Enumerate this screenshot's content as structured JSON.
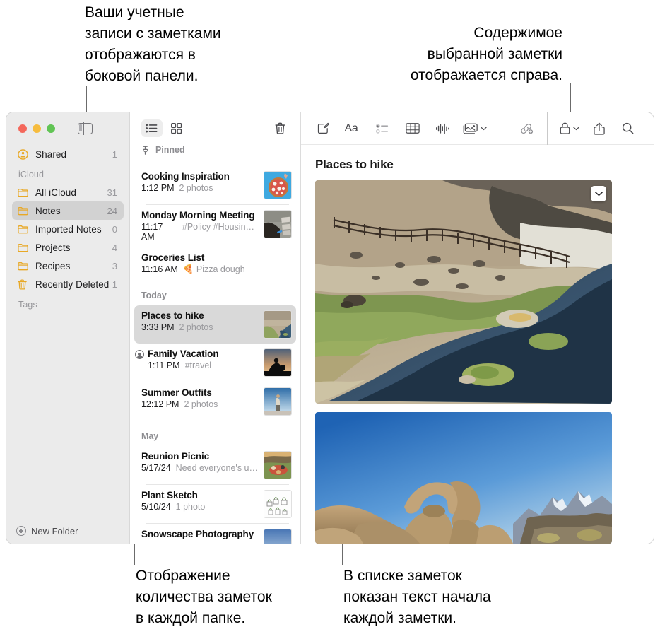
{
  "callouts": {
    "sidebar": "Ваши учетные\nзаписи с заметками\nотображаются в\nбоковой панели.",
    "content": "Содержимое\nвыбранной заметки\nотображается справа.",
    "counts": "Отображение\nколичества заметок\nв каждой папке.",
    "preview": "В списке заметок\nпоказан текст начала\nкаждой заметки."
  },
  "sidebar": {
    "shared": {
      "label": "Shared",
      "count": "1",
      "icon": "shared-person-icon"
    },
    "section_icloud": "iCloud",
    "section_tags": "Tags",
    "items": [
      {
        "label": "All iCloud",
        "count": "31",
        "icon": "folder-icon",
        "selected": false
      },
      {
        "label": "Notes",
        "count": "24",
        "icon": "folder-icon",
        "selected": true
      },
      {
        "label": "Imported Notes",
        "count": "0",
        "icon": "folder-icon",
        "selected": false
      },
      {
        "label": "Projects",
        "count": "4",
        "icon": "folder-icon",
        "selected": false
      },
      {
        "label": "Recipes",
        "count": "3",
        "icon": "folder-icon",
        "selected": false
      },
      {
        "label": "Recently Deleted",
        "count": "1",
        "icon": "trash-icon",
        "selected": false
      }
    ],
    "new_folder": "New Folder"
  },
  "list_toolbar": {
    "list_view": "list-view-icon",
    "gallery_view": "gallery-view-icon",
    "delete": "trash-icon"
  },
  "notes_list": {
    "pinned_header": "Pinned",
    "groups": [
      {
        "header": null,
        "notes": [
          {
            "title": "Cooking Inspiration",
            "time": "1:12 PM",
            "snippet": "2 photos",
            "thumb": "pizza",
            "shared": false
          },
          {
            "title": "Monday Morning Meeting",
            "time": "11:17 AM",
            "snippet": "#Policy #Housing…",
            "thumb": "desk",
            "shared": false
          },
          {
            "title": "Groceries List",
            "time": "11:16 AM",
            "snippet": "🍕 Pizza dough",
            "thumb": null,
            "shared": false
          }
        ]
      },
      {
        "header": "Today",
        "notes": [
          {
            "title": "Places to hike",
            "time": "3:33 PM",
            "snippet": "2 photos",
            "thumb": "creek",
            "shared": false,
            "selected": true
          },
          {
            "title": "Family Vacation",
            "time": "1:11 PM",
            "snippet": "#travel",
            "thumb": "sunset",
            "shared": true
          },
          {
            "title": "Summer Outfits",
            "time": "12:12 PM",
            "snippet": "2 photos",
            "thumb": "outfit",
            "shared": false
          }
        ]
      },
      {
        "header": "May",
        "notes": [
          {
            "title": "Reunion Picnic",
            "time": "5/17/24",
            "snippet": "Need everyone's u…",
            "thumb": "picnic",
            "shared": false
          },
          {
            "title": "Plant Sketch",
            "time": "5/10/24",
            "snippet": "1 photo",
            "thumb": "plants",
            "shared": false
          },
          {
            "title": "Snowscape Photography",
            "time": "",
            "snippet": "",
            "thumb": "snow",
            "shared": false
          }
        ]
      }
    ]
  },
  "content_toolbar": {
    "icons": [
      "compose-icon",
      "format-aa-icon",
      "checklist-icon",
      "table-icon",
      "audio-waveform-icon",
      "media-icon",
      "media-chevron-down-icon",
      "add-link-icon",
      "lock-icon",
      "lock-chevron-down-icon",
      "share-icon",
      "search-icon"
    ]
  },
  "note_detail": {
    "title": "Places to hike",
    "photo1_alt": "hot-creek-river-photo",
    "photo2_alt": "mobius-arch-photo",
    "photo_menu_icon": "chevron-down-icon"
  },
  "colors": {
    "folder_yellow": "#e8a825",
    "sidebar_bg": "#ebebeb",
    "selection_gray": "#d2d2d2",
    "note_selection_gray": "#d9d9d9",
    "traffic_red": "#f4675b",
    "traffic_amber": "#f6bc3e",
    "traffic_green": "#61c454",
    "muted_text": "#9a9a9e"
  }
}
